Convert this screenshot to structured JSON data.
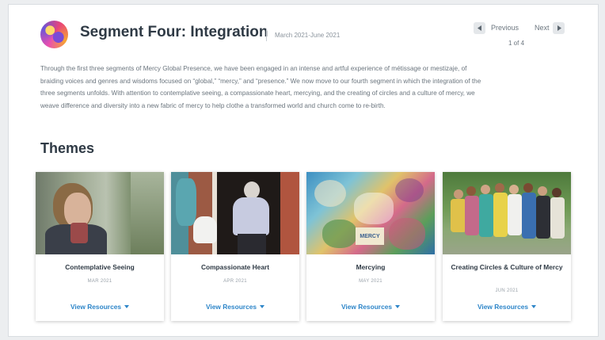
{
  "header": {
    "title": "Segment Four: Integration",
    "dates": "March 2021-June 2021"
  },
  "pager": {
    "previous_label": "Previous",
    "next_label": "Next",
    "page_count": "1 of 4"
  },
  "intro": "Through the first three segments of Mercy Global Presence, we have been engaged in an intense and artful experience of métissage or mestizaje, of braiding voices and genres and wisdoms focused on “global,” “mercy,” and “presence.” We now move to our fourth segment in which the integration of the three segments unfolds. With attention to contemplative seeing, a compassionate heart, mercying, and the creating of circles and a culture of mercy, we weave difference and diversity into a new fabric of mercy to help clothe a transformed world and church come to re-birth.",
  "themes": {
    "heading": "Themes",
    "view_label": "View Resources",
    "cards": [
      {
        "title": "Contemplative Seeing",
        "date": "MAR 2021"
      },
      {
        "title": "Compassionate Heart",
        "date": "APR 2021"
      },
      {
        "title": "Mercying",
        "date": "MAY 2021"
      },
      {
        "title": "Creating Circles & Culture of Mercy",
        "date": "JUN 2021"
      }
    ]
  },
  "mercy_image_text": "MERCY",
  "icons": {
    "logo": "mercy-global-presence-logo",
    "prev": "chevron-left-icon",
    "next": "chevron-right-icon",
    "dropdown": "caret-down-icon"
  },
  "colors": {
    "accent": "#2e86c9",
    "title": "#2f3a45",
    "body_text": "#6b757e"
  }
}
